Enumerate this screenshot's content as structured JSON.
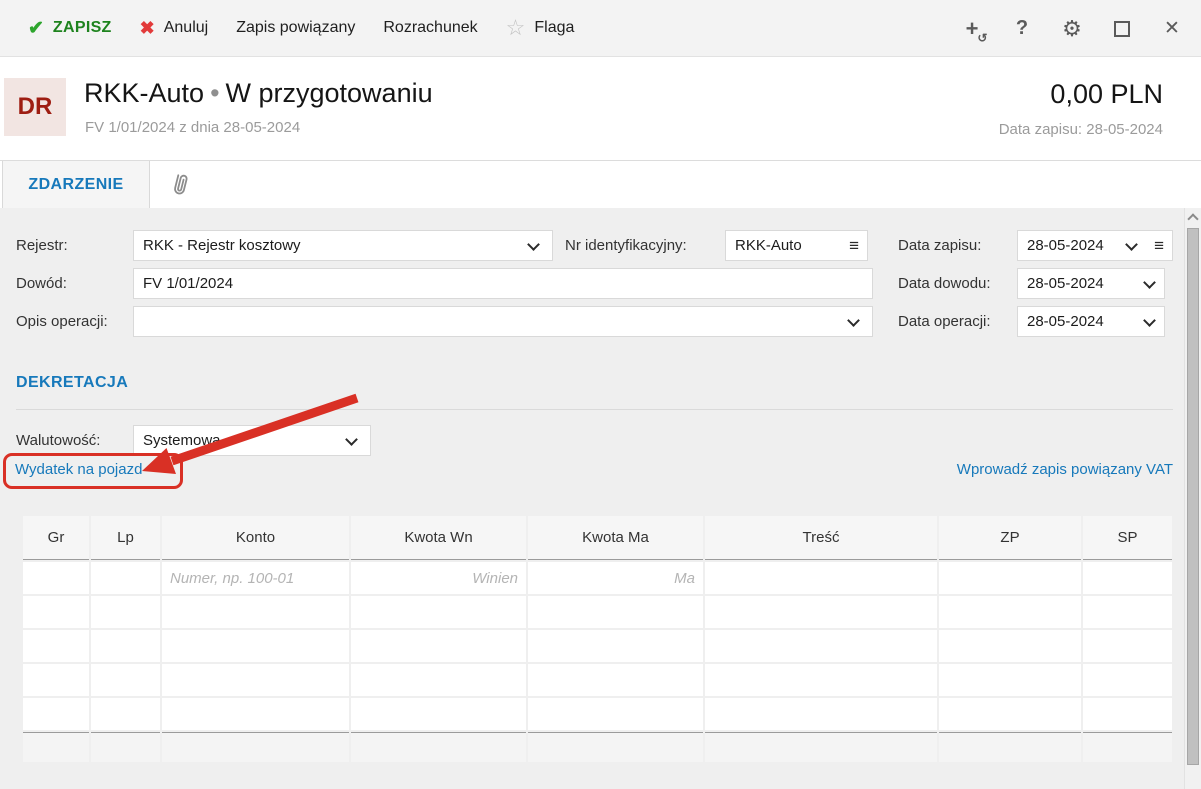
{
  "toolbar": {
    "save": "ZAPISZ",
    "cancel": "Anuluj",
    "related_entry": "Zapis powiązany",
    "settlement": "Rozrachunek",
    "flag": "Flaga"
  },
  "icons": {
    "check": "✔",
    "cancel_x": "✖",
    "star": "☆",
    "plus": "+",
    "plus_refresh": "↺",
    "help": "?",
    "gear": "⚙",
    "close": "✕",
    "hamburger": "≡"
  },
  "header": {
    "badge": "DR",
    "title": "RKK-Auto",
    "separator": "•",
    "status": "W przygotowaniu",
    "subtitle": "FV 1/01/2024 z dnia 28-05-2024",
    "amount": "0,00 PLN",
    "save_date": "Data zapisu: 28-05-2024"
  },
  "tabs": {
    "event": "ZDARZENIE"
  },
  "form": {
    "rejestr": {
      "label": "Rejestr:",
      "value": "RKK - Rejestr kosztowy"
    },
    "nr_id": {
      "label": "Nr identyfikacyjny:",
      "value": "RKK-Auto"
    },
    "data_zapisu": {
      "label": "Data zapisu:",
      "value": "28-05-2024"
    },
    "dowod": {
      "label": "Dowód:",
      "value": "FV 1/01/2024"
    },
    "data_dowodu": {
      "label": "Data dowodu:",
      "value": "28-05-2024"
    },
    "opis": {
      "label": "Opis operacji:",
      "value": ""
    },
    "data_operacji": {
      "label": "Data operacji:",
      "value": "28-05-2024"
    }
  },
  "dekretacja": {
    "section_title": "DEKRETACJA",
    "walutowosc": {
      "label": "Walutowość:",
      "value": "Systemowa"
    },
    "vehicle_link": "Wydatek na pojazd",
    "vat_link": "Wprowadź zapis powiązany VAT"
  },
  "table": {
    "columns": [
      "Gr",
      "Lp",
      "Konto",
      "Kwota Wn",
      "Kwota Ma",
      "Treść",
      "ZP",
      "SP"
    ],
    "placeholders": {
      "konto": "Numer, np. 100-01",
      "kwota_wn": "Winien",
      "kwota_ma": "Ma"
    },
    "empty_rows": 4
  },
  "colors": {
    "accent_blue": "#1779bb",
    "save_green": "#1e831e",
    "cancel_red": "#e23a3a",
    "annotation_red": "#d93025",
    "badge_bg": "#f2e5e2",
    "badge_text": "#9e1d12",
    "panel_bg": "#efefef"
  }
}
